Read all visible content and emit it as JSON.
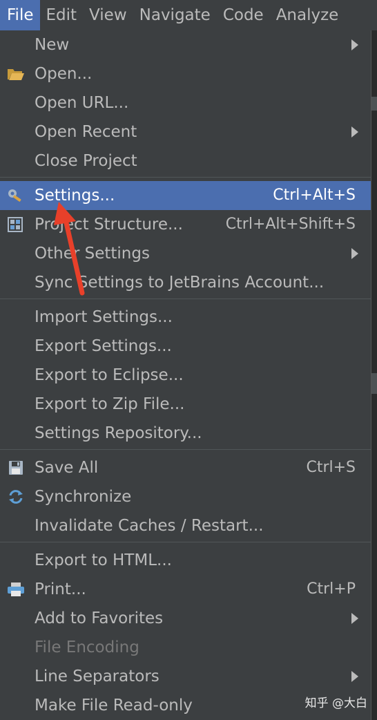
{
  "menubar": {
    "items": [
      {
        "label": "File",
        "active": true
      },
      {
        "label": "Edit"
      },
      {
        "label": "View"
      },
      {
        "label": "Navigate"
      },
      {
        "label": "Code"
      },
      {
        "label": "Analyze"
      }
    ]
  },
  "file_menu": {
    "new": {
      "label": "New"
    },
    "open": {
      "label": "Open..."
    },
    "open_url": {
      "label": "Open URL..."
    },
    "open_recent": {
      "label": "Open Recent"
    },
    "close_project": {
      "label": "Close Project"
    },
    "settings": {
      "label": "Settings...",
      "shortcut": "Ctrl+Alt+S",
      "selected": true
    },
    "project_structure": {
      "label": "Project Structure...",
      "shortcut": "Ctrl+Alt+Shift+S"
    },
    "other_settings": {
      "label": "Other Settings"
    },
    "sync_settings": {
      "label": "Sync Settings to JetBrains Account..."
    },
    "import_settings": {
      "label": "Import Settings..."
    },
    "export_settings": {
      "label": "Export Settings..."
    },
    "export_eclipse": {
      "label": "Export to Eclipse..."
    },
    "export_zip": {
      "label": "Export to Zip File..."
    },
    "settings_repository": {
      "label": "Settings Repository..."
    },
    "save_all": {
      "label": "Save All",
      "shortcut": "Ctrl+S"
    },
    "synchronize": {
      "label": "Synchronize"
    },
    "invalidate_caches": {
      "label": "Invalidate Caches / Restart..."
    },
    "export_html": {
      "label": "Export to HTML..."
    },
    "print": {
      "label": "Print...",
      "shortcut": "Ctrl+P"
    },
    "add_favorites": {
      "label": "Add to Favorites"
    },
    "file_encoding": {
      "label": "File Encoding",
      "disabled": true
    },
    "line_separators": {
      "label": "Line Separators"
    },
    "make_read_only": {
      "label": "Make File Read-only"
    }
  },
  "watermark": "知乎 @大白",
  "colors": {
    "background": "#3c3f41",
    "selection": "#4b6eaf",
    "text": "#bbbbbb",
    "annotation_arrow": "#e8402a"
  }
}
